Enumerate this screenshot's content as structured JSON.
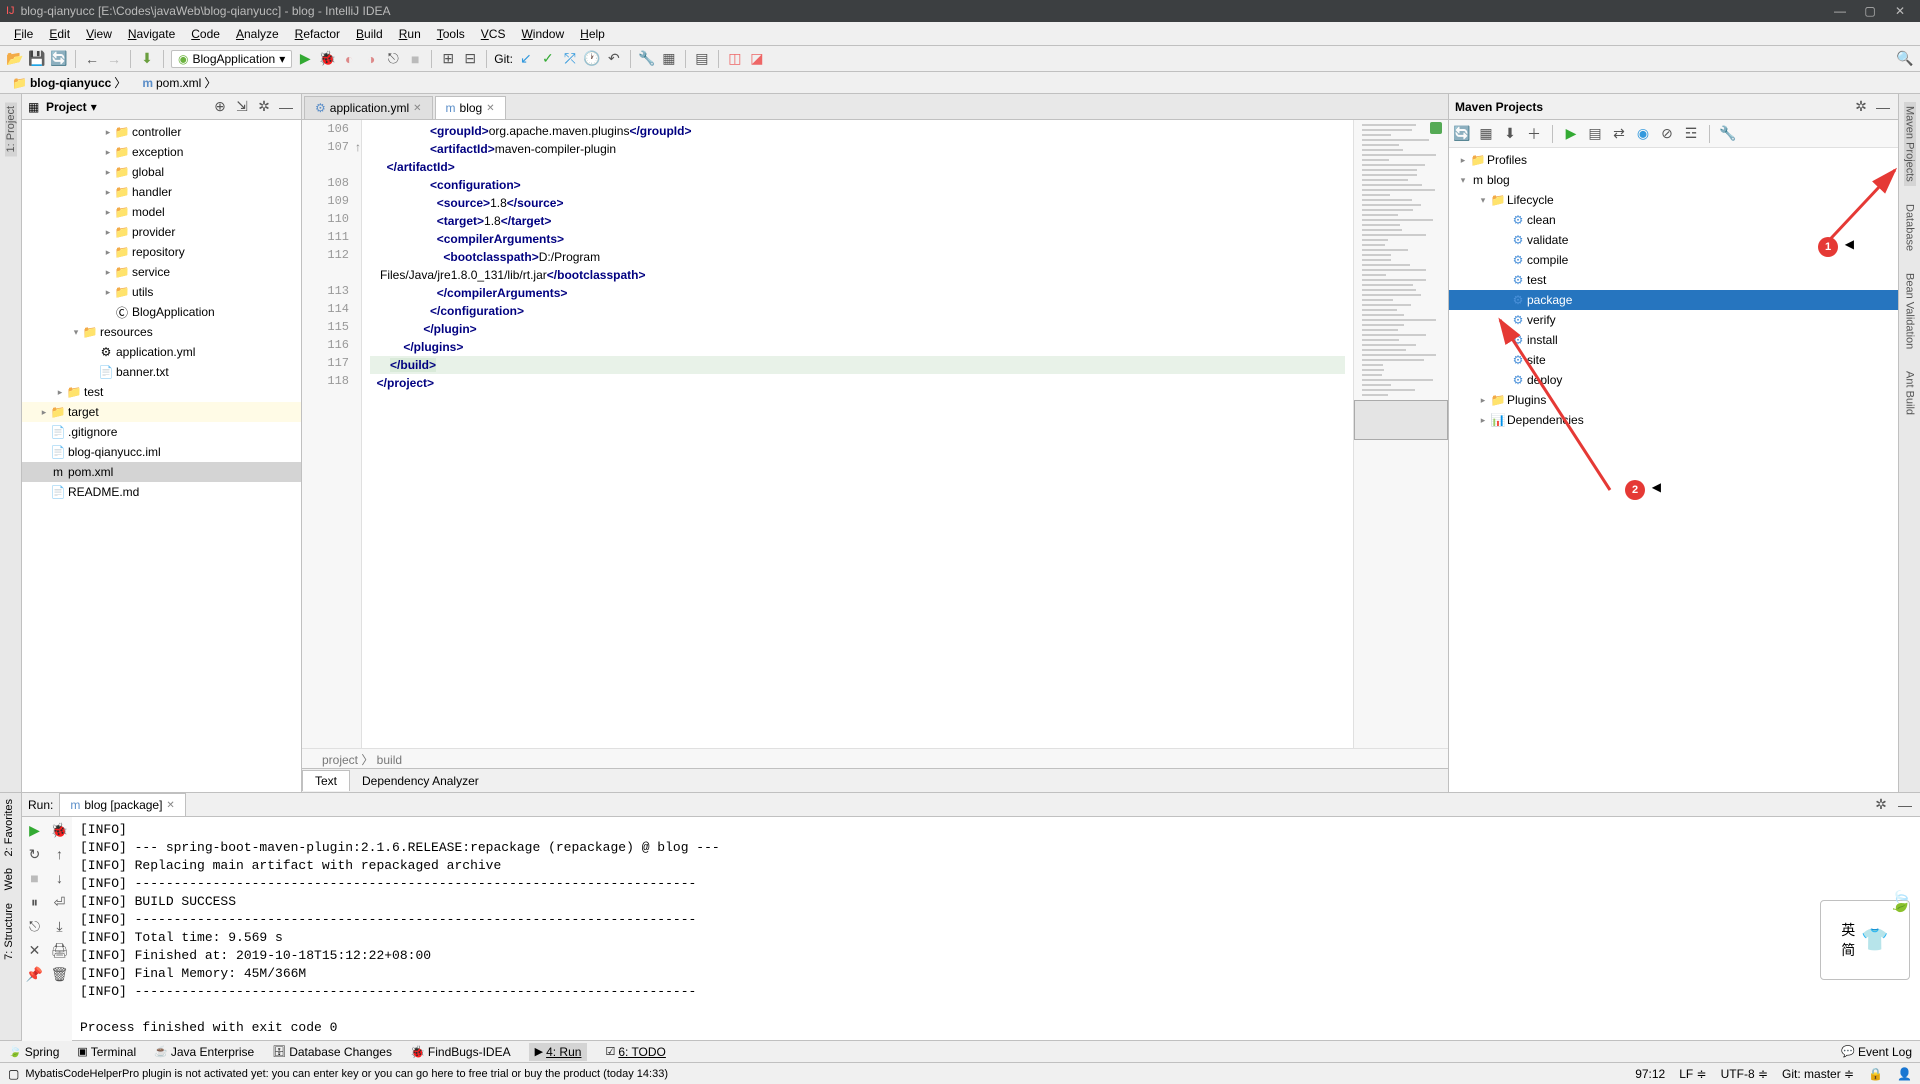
{
  "titlebar": {
    "title": "blog-qianyucc [E:\\Codes\\javaWeb\\blog-qianyucc] - blog - IntelliJ IDEA"
  },
  "menu": [
    "File",
    "Edit",
    "View",
    "Navigate",
    "Code",
    "Analyze",
    "Refactor",
    "Build",
    "Run",
    "Tools",
    "VCS",
    "Window",
    "Help"
  ],
  "toolbar": {
    "run_config": "BlogApplication",
    "git_label": "Git:"
  },
  "breadcrumb": {
    "root": "blog-qianyucc",
    "file": "pom.xml"
  },
  "project_panel": {
    "title": "Project",
    "tree": [
      {
        "indent": 5,
        "arrow": ">",
        "icon": "📁",
        "label": "controller"
      },
      {
        "indent": 5,
        "arrow": ">",
        "icon": "📁",
        "label": "exception"
      },
      {
        "indent": 5,
        "arrow": ">",
        "icon": "📁",
        "label": "global"
      },
      {
        "indent": 5,
        "arrow": ">",
        "icon": "📁",
        "label": "handler"
      },
      {
        "indent": 5,
        "arrow": ">",
        "icon": "📁",
        "label": "model"
      },
      {
        "indent": 5,
        "arrow": ">",
        "icon": "📁",
        "label": "provider"
      },
      {
        "indent": 5,
        "arrow": ">",
        "icon": "📁",
        "label": "repository"
      },
      {
        "indent": 5,
        "arrow": ">",
        "icon": "📁",
        "label": "service"
      },
      {
        "indent": 5,
        "arrow": ">",
        "icon": "📁",
        "label": "utils"
      },
      {
        "indent": 5,
        "arrow": "",
        "icon": "Ⓒ",
        "label": "BlogApplication"
      },
      {
        "indent": 3,
        "arrow": "v",
        "icon": "📁",
        "label": "resources",
        "orange": true
      },
      {
        "indent": 4,
        "arrow": "",
        "icon": "⚙",
        "label": "application.yml"
      },
      {
        "indent": 4,
        "arrow": "",
        "icon": "📄",
        "label": "banner.txt"
      },
      {
        "indent": 2,
        "arrow": ">",
        "icon": "📁",
        "label": "test"
      },
      {
        "indent": 1,
        "arrow": ">",
        "icon": "📁",
        "label": "target",
        "orange": true,
        "highlight": true
      },
      {
        "indent": 1,
        "arrow": "",
        "icon": "📄",
        "label": ".gitignore"
      },
      {
        "indent": 1,
        "arrow": "",
        "icon": "📄",
        "label": "blog-qianyucc.iml"
      },
      {
        "indent": 1,
        "arrow": "",
        "icon": "m",
        "label": "pom.xml",
        "selected": true
      },
      {
        "indent": 1,
        "arrow": "",
        "icon": "📄",
        "label": "README.md"
      }
    ]
  },
  "editor": {
    "tabs": [
      {
        "icon": "⚙",
        "label": "application.yml",
        "active": false
      },
      {
        "icon": "m",
        "label": "blog",
        "active": true
      }
    ],
    "lines": [
      "106",
      "107",
      "",
      "108",
      "109",
      "110",
      "111",
      "112",
      "",
      "113",
      "114",
      "115",
      "116",
      "117",
      "118"
    ],
    "code_lines": [
      {
        "pad": 18,
        "open": "groupId",
        "text": "org.apache.maven.plugins",
        "close": "groupId"
      },
      {
        "pad": 18,
        "open": "artifactId",
        "text": "maven-compiler-plugin"
      },
      {
        "pad": 5,
        "close": "artifactId"
      },
      {
        "pad": 18,
        "open": "configuration"
      },
      {
        "pad": 20,
        "open": "source",
        "text": "1.8",
        "close": "source"
      },
      {
        "pad": 20,
        "open": "target",
        "text": "1.8",
        "close": "target"
      },
      {
        "pad": 20,
        "open": "compilerArguments"
      },
      {
        "pad": 22,
        "open": "bootclasspath",
        "text": "D:/Program"
      },
      {
        "pad": 3,
        "plain": "Files/Java/jre1.8.0_131/lib/rt.jar",
        "close": "bootclasspath"
      },
      {
        "pad": 20,
        "close": "compilerArguments"
      },
      {
        "pad": 18,
        "close": "configuration"
      },
      {
        "pad": 16,
        "close": "plugin"
      },
      {
        "pad": 10,
        "close": "plugins"
      },
      {
        "pad": 6,
        "close": "build",
        "hl": true
      },
      {
        "pad": 2,
        "close": "project"
      }
    ],
    "crumb": "project  〉 build",
    "bottom_tabs": [
      "Text",
      "Dependency Analyzer"
    ]
  },
  "maven": {
    "title": "Maven Projects",
    "tree": [
      {
        "indent": 0,
        "arrow": ">",
        "icon": "📁",
        "label": "Profiles"
      },
      {
        "indent": 0,
        "arrow": "v",
        "icon": "m",
        "label": "blog"
      },
      {
        "indent": 1,
        "arrow": "v",
        "icon": "📁",
        "label": "Lifecycle"
      },
      {
        "indent": 2,
        "arrow": "",
        "icon": "⚙",
        "label": "clean",
        "gear": true
      },
      {
        "indent": 2,
        "arrow": "",
        "icon": "⚙",
        "label": "validate",
        "gear": true
      },
      {
        "indent": 2,
        "arrow": "",
        "icon": "⚙",
        "label": "compile",
        "gear": true
      },
      {
        "indent": 2,
        "arrow": "",
        "icon": "⚙",
        "label": "test",
        "gear": true
      },
      {
        "indent": 2,
        "arrow": "",
        "icon": "⚙",
        "label": "package",
        "gear": true,
        "selected": true
      },
      {
        "indent": 2,
        "arrow": "",
        "icon": "⚙",
        "label": "verify",
        "gear": true
      },
      {
        "indent": 2,
        "arrow": "",
        "icon": "⚙",
        "label": "install",
        "gear": true
      },
      {
        "indent": 2,
        "arrow": "",
        "icon": "⚙",
        "label": "site",
        "gear": true
      },
      {
        "indent": 2,
        "arrow": "",
        "icon": "⚙",
        "label": "deploy",
        "gear": true
      },
      {
        "indent": 1,
        "arrow": ">",
        "icon": "📁",
        "label": "Plugins"
      },
      {
        "indent": 1,
        "arrow": ">",
        "icon": "📊",
        "label": "Dependencies"
      }
    ]
  },
  "left_tabs": [
    "1: Project"
  ],
  "left_tabs2": [
    "2: Favorites",
    "Web",
    "7: Structure"
  ],
  "right_tabs": [
    "Maven Projects",
    "Database",
    "Bean Validation",
    "Ant Build"
  ],
  "run": {
    "label": "Run:",
    "tab": "blog [package]",
    "output": "[INFO]\n[INFO] --- spring-boot-maven-plugin:2.1.6.RELEASE:repackage (repackage) @ blog ---\n[INFO] Replacing main artifact with repackaged archive\n[INFO] ------------------------------------------------------------------------\n[INFO] BUILD SUCCESS\n[INFO] ------------------------------------------------------------------------\n[INFO] Total time: 9.569 s\n[INFO] Finished at: 2019-10-18T15:12:22+08:00\n[INFO] Final Memory: 45M/366M\n[INFO] ------------------------------------------------------------------------\n\nProcess finished with exit code 0"
  },
  "bottombar": {
    "items": [
      "Spring",
      "Terminal",
      "Java Enterprise",
      "Database Changes",
      "FindBugs-IDEA",
      "4: Run",
      "6: TODO"
    ],
    "event": "Event Log"
  },
  "statusbar": {
    "msg": "MybatisCodeHelperPro plugin is not activated yet: you can enter key or you can go here to free trial or buy the product (today 14:33)",
    "pos": "97:12",
    "le": "LF ≑",
    "enc": "UTF-8 ≑",
    "git": "Git: master ≑"
  },
  "annotations": {
    "badge1": "1",
    "badge2": "2",
    "widget": "英\n简"
  }
}
